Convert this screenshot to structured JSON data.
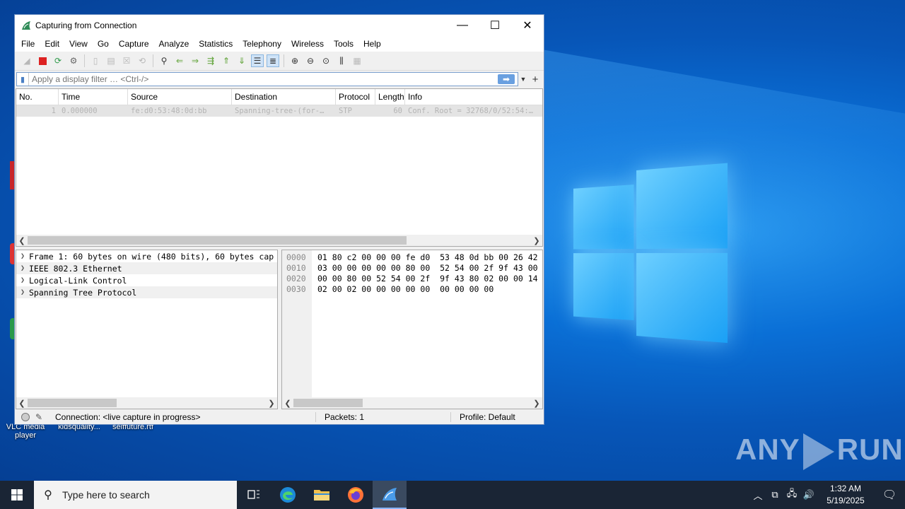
{
  "window": {
    "title": "Capturing from Connection",
    "controls": {
      "minimize": "—",
      "maximize": "☐",
      "close": "✕"
    }
  },
  "menu": [
    "File",
    "Edit",
    "View",
    "Go",
    "Capture",
    "Analyze",
    "Statistics",
    "Telephony",
    "Wireless",
    "Tools",
    "Help"
  ],
  "filter": {
    "placeholder": "Apply a display filter … <Ctrl-/>",
    "value": ""
  },
  "packet_list": {
    "columns": [
      "No.",
      "Time",
      "Source",
      "Destination",
      "Protocol",
      "Length",
      "Info"
    ],
    "rows": [
      {
        "no": "1",
        "time": "0.000000",
        "source": "fe:d0:53:48:0d:bb",
        "destination": "Spanning-tree-(for-…",
        "protocol": "STP",
        "length": "60",
        "info": "Conf. Root = 32768/0/52:54:…"
      }
    ]
  },
  "details": [
    "Frame 1: 60 bytes on wire (480 bits), 60 bytes cap",
    "IEEE 802.3 Ethernet",
    "Logical-Link Control",
    "Spanning Tree Protocol"
  ],
  "bytes": [
    {
      "offset": "0000",
      "hex": "01 80 c2 00 00 00 fe d0  53 48 0d bb 00 26 42"
    },
    {
      "offset": "0010",
      "hex": "03 00 00 00 00 00 80 00  52 54 00 2f 9f 43 00"
    },
    {
      "offset": "0020",
      "hex": "00 00 80 00 52 54 00 2f  9f 43 80 02 00 00 14"
    },
    {
      "offset": "0030",
      "hex": "02 00 02 00 00 00 00 00  00 00 00 00"
    }
  ],
  "status": {
    "connection": "Connection: <live capture in progress>",
    "packets": "Packets: 1",
    "profile": "Profile: Default"
  },
  "desktop_icons": [
    {
      "label": "VLC media player"
    },
    {
      "label": "kidsquality..."
    },
    {
      "label": "selffuture.rtf"
    }
  ],
  "watermark": "ANY RUN",
  "taskbar": {
    "search_placeholder": "Type here to search",
    "time": "1:32 AM",
    "date": "5/19/2025"
  }
}
